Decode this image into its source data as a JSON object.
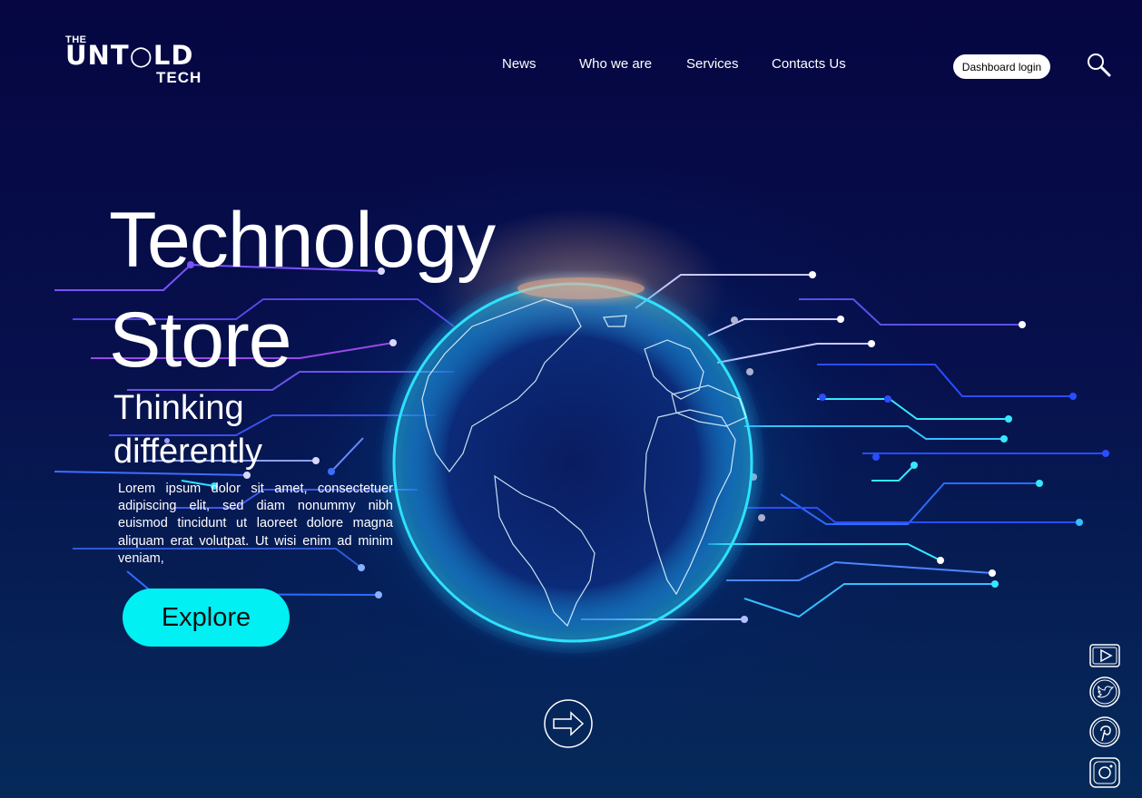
{
  "brand": {
    "the": "THE",
    "untold": "UNT○LD",
    "tech": "TECH"
  },
  "nav": {
    "items": [
      "News",
      "Who we are",
      "Services",
      "Contacts Us"
    ],
    "login_label": "Dashboard login"
  },
  "icons": {
    "search": "search-icon",
    "next": "arrow-right-icon",
    "social": [
      "youtube-icon",
      "twitter-icon",
      "pinterest-icon",
      "instagram-icon"
    ]
  },
  "hero": {
    "title_line1": "Technology",
    "title_line2": "Store",
    "subtitle_line1": "Thinking",
    "subtitle_line2": "differently",
    "body": "Lorem ipsum dolor sit amet, consectetuer adipiscing elit, sed diam nonummy nibh euismod tincidunt ut laoreet dolore magna aliquam erat volutpat. Ut wisi enim ad minim veniam,",
    "cta": "Explore"
  },
  "colors": {
    "background": "#04063d",
    "accent": "#00f0f4",
    "globe_glow": "#2fe0ff",
    "circuit_blue": "#2a4dff",
    "circuit_cyan": "#36e8ff"
  }
}
